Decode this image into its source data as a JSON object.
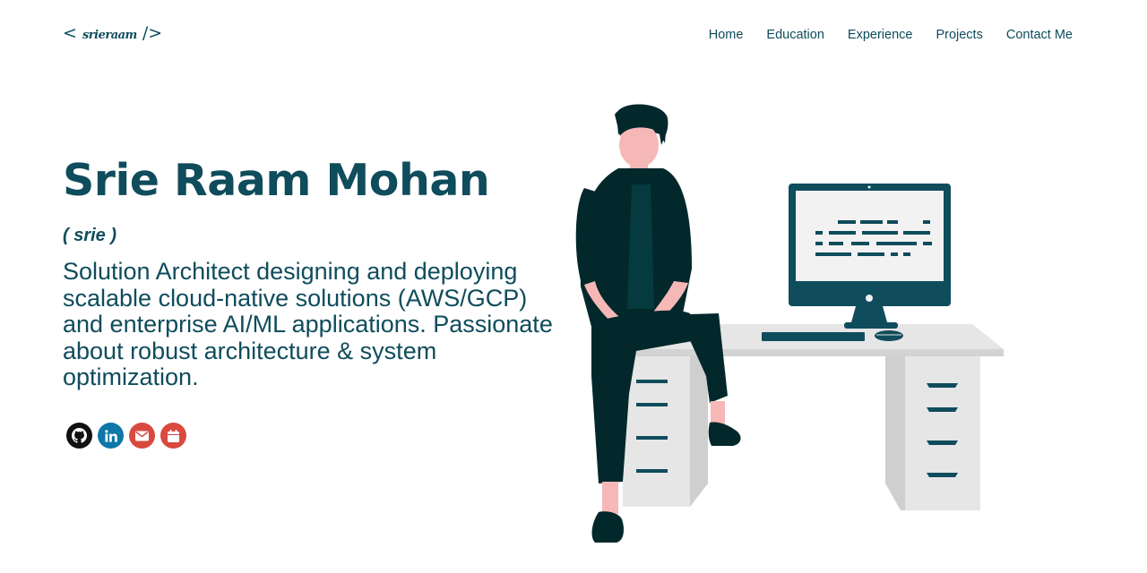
{
  "header": {
    "logo": {
      "open": "<",
      "signature": "srieraam",
      "close": "/>"
    },
    "nav": [
      "Home",
      "Education",
      "Experience",
      "Projects",
      "Contact Me"
    ]
  },
  "intro": {
    "name": "Srie Raam Mohan",
    "nickname": "( srie )",
    "bio": "Solution Architect designing and deploying scalable cloud-native solutions (AWS/GCP) and enterprise AI/ML applications. Passionate about robust architecture & system optimization."
  },
  "socials": [
    {
      "icon": "github-icon",
      "color": "#111111"
    },
    {
      "icon": "linkedin-icon",
      "color": "#0e76a8"
    },
    {
      "icon": "mail-icon",
      "color": "#d9493f"
    },
    {
      "icon": "calendar-icon",
      "color": "#d9493f"
    }
  ],
  "colors": {
    "primary": "#0f4c5c",
    "dark": "#03282b",
    "skin": "#f6b8b6",
    "desk": "#e6e6e6"
  }
}
